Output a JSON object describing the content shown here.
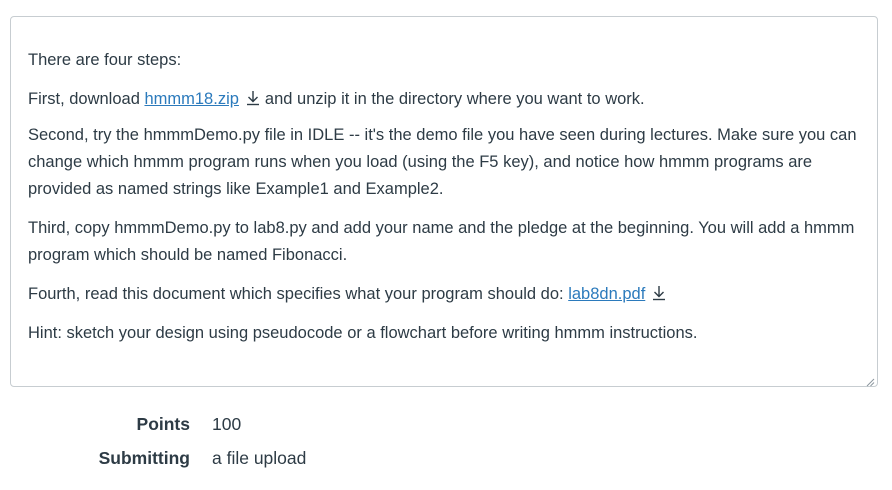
{
  "instructions": {
    "intro": "There are four steps:",
    "step1_before": "First, download ",
    "step1_link": "hmmm18.zip",
    "step1_after": "and unzip it in the directory where you want to work.",
    "step2": "Second, try the hmmmDemo.py file in IDLE -- it's the demo file you have seen during lectures.  Make sure you can change which hmmm program runs when you load (using the F5 key), and notice how hmmm programs are provided as named strings like Example1 and Example2.",
    "step3": "Third, copy hmmmDemo.py to lab8.py and add your name and the pledge at the beginning.  You will add a hmmm program which should be named Fibonacci.",
    "step4_before": "Fourth, read this document which specifies what your program should do: ",
    "step4_link": "lab8dn.pdf",
    "hint": "Hint: sketch your design using pseudocode or a flowchart before writing hmmm instructions."
  },
  "details": {
    "points_label": "Points",
    "points_value": "100",
    "submitting_label": "Submitting",
    "submitting_value": "a file upload"
  },
  "colors": {
    "link": "#2b7abc",
    "text": "#2d3b45",
    "border": "#c7cdd1"
  },
  "icons": {
    "download": "download-icon",
    "resize": "resize-grip-icon"
  }
}
